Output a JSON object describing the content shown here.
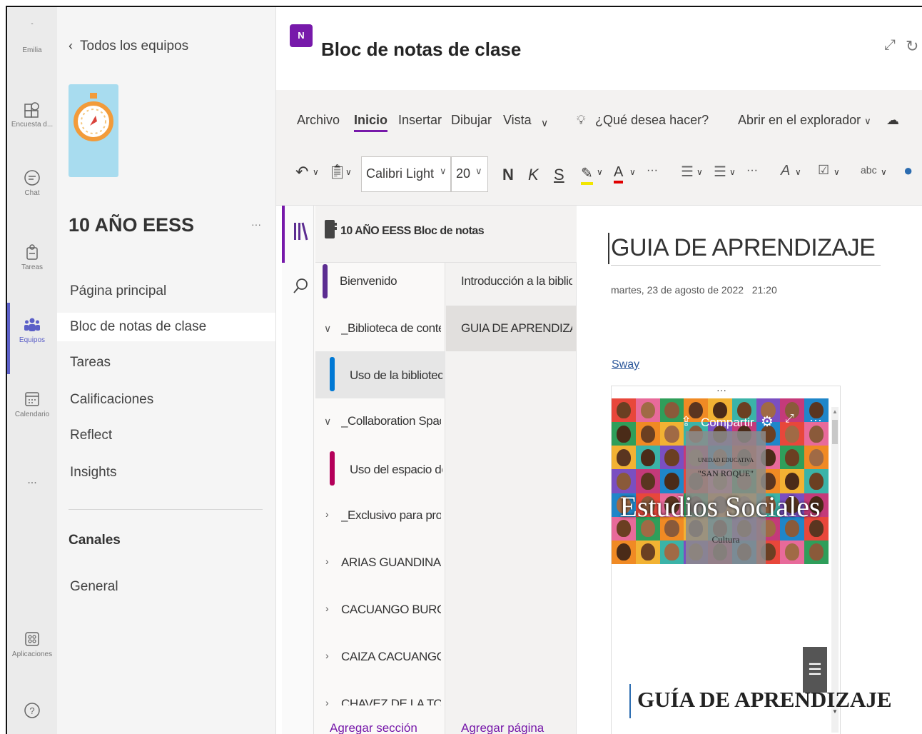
{
  "rail": {
    "user": "Emilia",
    "items": [
      {
        "label": "Encuesta d...",
        "icon": "survey-icon"
      },
      {
        "label": "Chat",
        "icon": "chat-icon"
      },
      {
        "label": "Tareas",
        "icon": "assignments-icon"
      },
      {
        "label": "Equipos",
        "icon": "teams-icon"
      },
      {
        "label": "Calendario",
        "icon": "calendar-icon"
      },
      {
        "label": "...",
        "icon": "more-icon"
      },
      {
        "label": "Aplicaciones",
        "icon": "apps-icon"
      },
      {
        "label": "",
        "icon": "help-icon"
      }
    ],
    "accent": "#5b5fc7"
  },
  "team": {
    "back_label": "Todos los equipos",
    "name": "10 AÑO EESS",
    "more": "···",
    "nav": [
      "Página principal",
      "Bloc de notas de clase",
      "Tareas",
      "Calificaciones",
      "Reflect",
      "Insights"
    ],
    "selected": "Bloc de notas de clase",
    "channels_heading": "Canales",
    "channels": [
      "General"
    ]
  },
  "app": {
    "title": "Bloc de notas de clase",
    "icon_text": "N",
    "brand_color": "#7719aa"
  },
  "ribbon": {
    "tabs": [
      "Archivo",
      "Inicio",
      "Insertar",
      "Dibujar",
      "Vista"
    ],
    "active_tab": "Inicio",
    "search_placeholder": "¿Qué desea hacer?",
    "open_in_browser": "Abrir en el explorador",
    "font": "Calibri Light",
    "size": "20",
    "bold": "N",
    "italic": "K",
    "underline": "S"
  },
  "notebook": {
    "title": "10 AÑO EESS Bloc de notas",
    "sections": [
      {
        "label": "Bienvenido",
        "color": "#5c2d91"
      },
      {
        "label": "_Biblioteca de conteni...",
        "group": true,
        "expanded": true
      },
      {
        "label": "Uso de la biblioteca...",
        "color": "#0078d4",
        "selected": true
      },
      {
        "label": "_Collaboration Space",
        "group": true,
        "expanded": true
      },
      {
        "label": "Uso del espacio de ...",
        "color": "#b4005a"
      },
      {
        "label": "_Exclusivo para profes...",
        "group": true,
        "expanded": false
      },
      {
        "label": "ARIAS GUANDINANG...",
        "group": true,
        "expanded": false
      },
      {
        "label": "CACUANGO BURGA E...",
        "group": true,
        "expanded": false
      },
      {
        "label": "CAIZA CACUANGO JA...",
        "group": true,
        "expanded": false
      },
      {
        "label": "CHAVEZ DE LA TORRE",
        "group": true,
        "expanded": false
      }
    ],
    "pages": [
      "Introducción a la bibliot...",
      "GUIA DE APRENDIZAJE"
    ],
    "selected_page": "GUIA DE APRENDIZAJE",
    "add_section": "Agregar sección",
    "add_page": "Agregar página"
  },
  "page": {
    "title": "GUIA DE APRENDIZAJE",
    "date": "martes, 23 de agosto de 2022",
    "time": "21:20",
    "link": "Sway",
    "embed": {
      "dots": "···",
      "share": "Compartir",
      "school_line1": "UNIDAD EDUCATIVA",
      "school_line2": "\"SAN ROQUE\"",
      "subject": "Estudios Sociales",
      "subtitle": "Cultura",
      "heading": "GUÍA DE APRENDIZAJE"
    }
  }
}
